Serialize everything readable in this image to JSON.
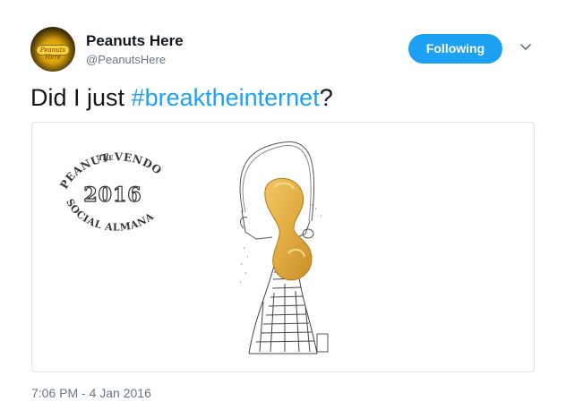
{
  "user": {
    "display_name": "Peanuts Here",
    "handle": "@PeanutsHere",
    "avatar_text": "Peanuts Here"
  },
  "follow_button": {
    "label": "Following"
  },
  "tweet": {
    "text_before": "Did I just ",
    "hashtag": "#breaktheinternet",
    "text_after": "?",
    "timestamp": "7:06 PM - 4 Jan 2016"
  },
  "media": {
    "logo": {
      "the": "THE",
      "arc_top": "PEANUT VENDOR'S",
      "year": "2016",
      "arc_bottom": "SOCIAL ALMANAC"
    }
  },
  "colors": {
    "accent": "#1da1f2",
    "text": "#14171a",
    "secondary_text": "#657786",
    "border": "#e1e8ed",
    "peanut": "#e2ad42"
  }
}
